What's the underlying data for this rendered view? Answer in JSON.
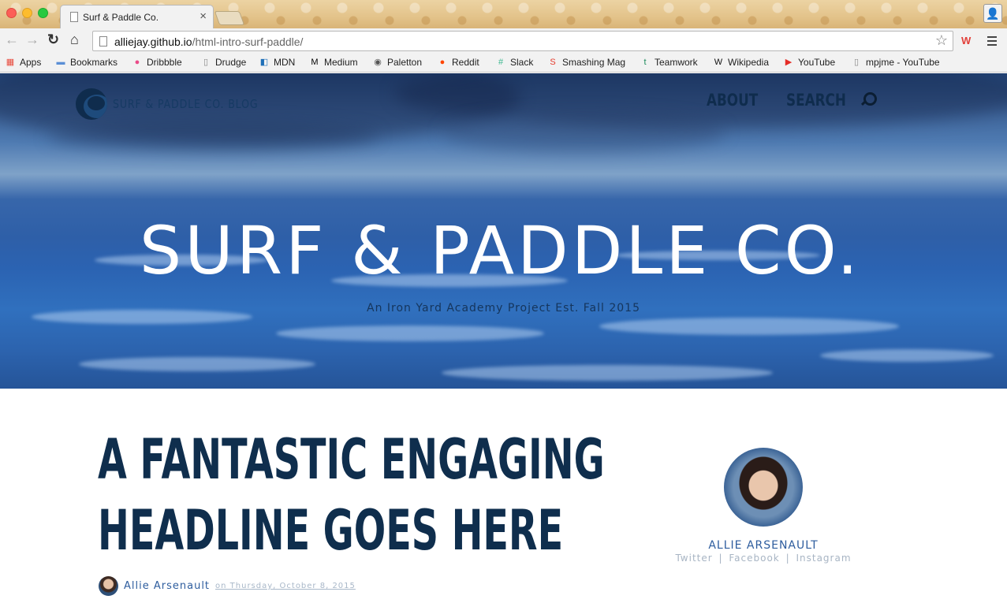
{
  "browser": {
    "tab_title": "Surf & Paddle Co.",
    "url_host": "alliejay.github.io",
    "url_path": "/html-intro-surf-paddle/",
    "bookmarks": [
      {
        "label": "Apps",
        "icon": "apps-grid-icon",
        "color": "#e84a3c"
      },
      {
        "label": "Bookmarks",
        "icon": "folder-icon",
        "color": "#5b8fd6"
      },
      {
        "label": "Dribbble",
        "icon": "dribbble-icon",
        "color": "#ea4c89"
      },
      {
        "label": "Drudge",
        "icon": "page-icon",
        "color": "#888888"
      },
      {
        "label": "MDN",
        "icon": "mdn-icon",
        "color": "#1d6fb8"
      },
      {
        "label": "Medium",
        "icon": "medium-icon",
        "color": "#000000"
      },
      {
        "label": "Paletton",
        "icon": "paletton-icon",
        "color": "#555555"
      },
      {
        "label": "Reddit",
        "icon": "reddit-icon",
        "color": "#ff4500"
      },
      {
        "label": "Slack",
        "icon": "slack-icon",
        "color": "#3eb890"
      },
      {
        "label": "Smashing Mag",
        "icon": "smashing-icon",
        "color": "#e53b2c"
      },
      {
        "label": "Teamwork",
        "icon": "teamwork-icon",
        "color": "#1b8a5a"
      },
      {
        "label": "Wikipedia",
        "icon": "wikipedia-icon",
        "color": "#111111"
      },
      {
        "label": "YouTube",
        "icon": "youtube-icon",
        "color": "#e52d27"
      },
      {
        "label": "mpjme - YouTube",
        "icon": "page-icon",
        "color": "#888888"
      }
    ]
  },
  "site": {
    "brand": "SURF & PADDLE CO. BLOG",
    "nav": {
      "about": "ABOUT",
      "search": "SEARCH"
    },
    "hero_title": "SURF & PADDLE CO.",
    "hero_subtitle": "An Iron Yard Academy Project Est. Fall 2015"
  },
  "article": {
    "headline_line1": "A FANTASTIC ENGAGING",
    "headline_line2": "HEADLINE GOES HERE",
    "author": "Allie Arsenault",
    "date": "on Thursday, October 8, 2015"
  },
  "author_card": {
    "name": "ALLIE ARSENAULT",
    "twitter": "Twitter",
    "facebook": "Facebook",
    "instagram": "Instagram",
    "separator": "|"
  }
}
